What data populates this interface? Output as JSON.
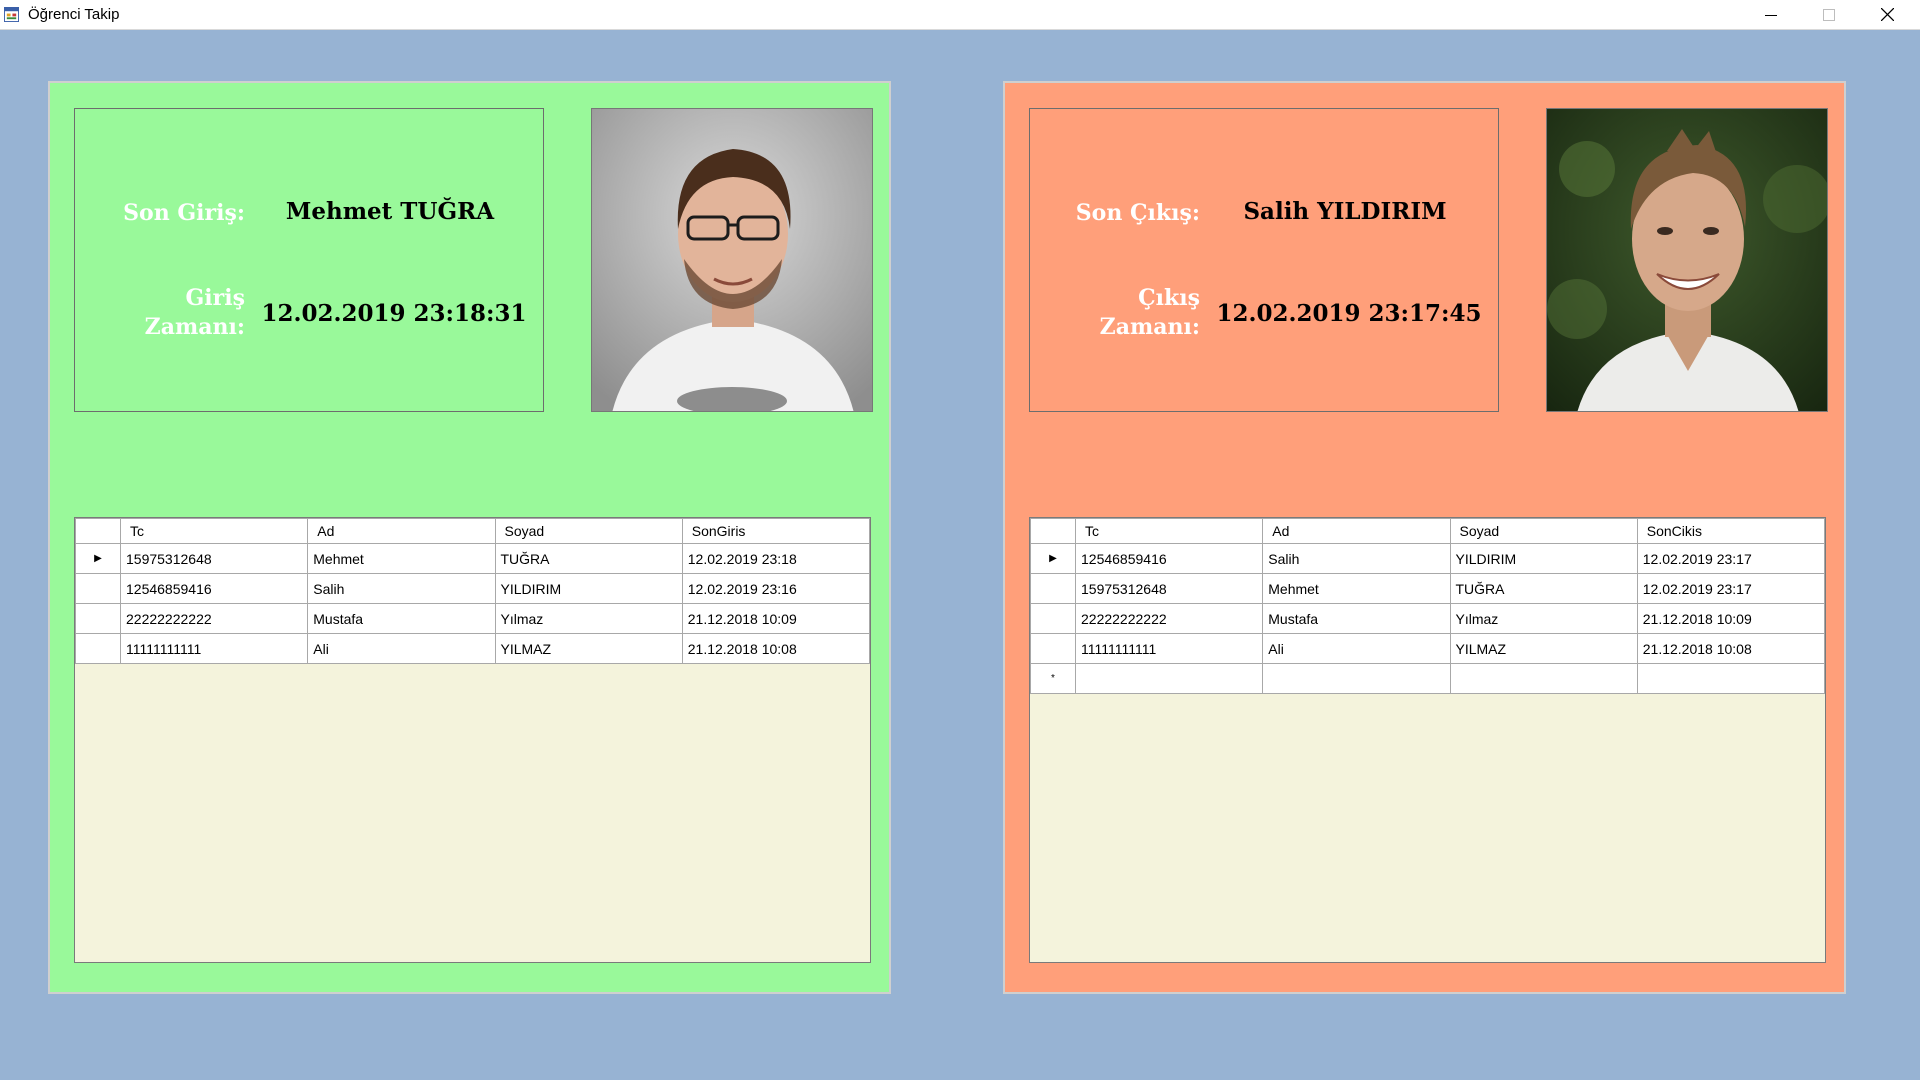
{
  "window": {
    "title": "Öğrenci Takip",
    "icon": "app-forms-icon",
    "controls": [
      "minimize-icon",
      "maximize-icon",
      "close-icon"
    ]
  },
  "colors": {
    "background": "#97b3d3",
    "entry_panel": "#99f99a",
    "exit_panel": "#ff9f7a",
    "grid_empty": "#f4f3dc"
  },
  "entry": {
    "name_label": "Son Giriş:",
    "name_value": "Mehmet TUĞRA",
    "time_label": "Giriş Zamanı:",
    "time_value": "12.02.2019 23:18:31",
    "columns": [
      "Tc",
      "Ad",
      "Soyad",
      "SonGiris"
    ],
    "rows": [
      {
        "marker": "▶",
        "tc": "15975312648",
        "ad": "Mehmet",
        "soyad": "TUĞRA",
        "son": "12.02.2019 23:18"
      },
      {
        "marker": "",
        "tc": "12546859416",
        "ad": "Salih",
        "soyad": "YILDIRIM",
        "son": "12.02.2019 23:16"
      },
      {
        "marker": "",
        "tc": "22222222222",
        "ad": "Mustafa",
        "soyad": "Yılmaz",
        "son": "21.12.2018 10:09"
      },
      {
        "marker": "",
        "tc": "11111111111",
        "ad": "Ali",
        "soyad": "YILMAZ",
        "son": "21.12.2018 10:08"
      }
    ]
  },
  "exit": {
    "name_label": "Son Çıkış:",
    "name_value": "Salih YILDIRIM",
    "time_label": "Çıkış Zamanı:",
    "time_value": "12.02.2019 23:17:45",
    "columns": [
      "Tc",
      "Ad",
      "Soyad",
      "SonCikis"
    ],
    "rows": [
      {
        "marker": "▶",
        "tc": "12546859416",
        "ad": "Salih",
        "soyad": "YILDIRIM",
        "son": "12.02.2019 23:17"
      },
      {
        "marker": "",
        "tc": "15975312648",
        "ad": "Mehmet",
        "soyad": "TUĞRA",
        "son": "12.02.2019 23:17"
      },
      {
        "marker": "",
        "tc": "22222222222",
        "ad": "Mustafa",
        "soyad": "Yılmaz",
        "son": "21.12.2018 10:09"
      },
      {
        "marker": "",
        "tc": "11111111111",
        "ad": "Ali",
        "soyad": "YILMAZ",
        "son": "21.12.2018 10:08"
      }
    ],
    "new_row_marker": "*"
  }
}
